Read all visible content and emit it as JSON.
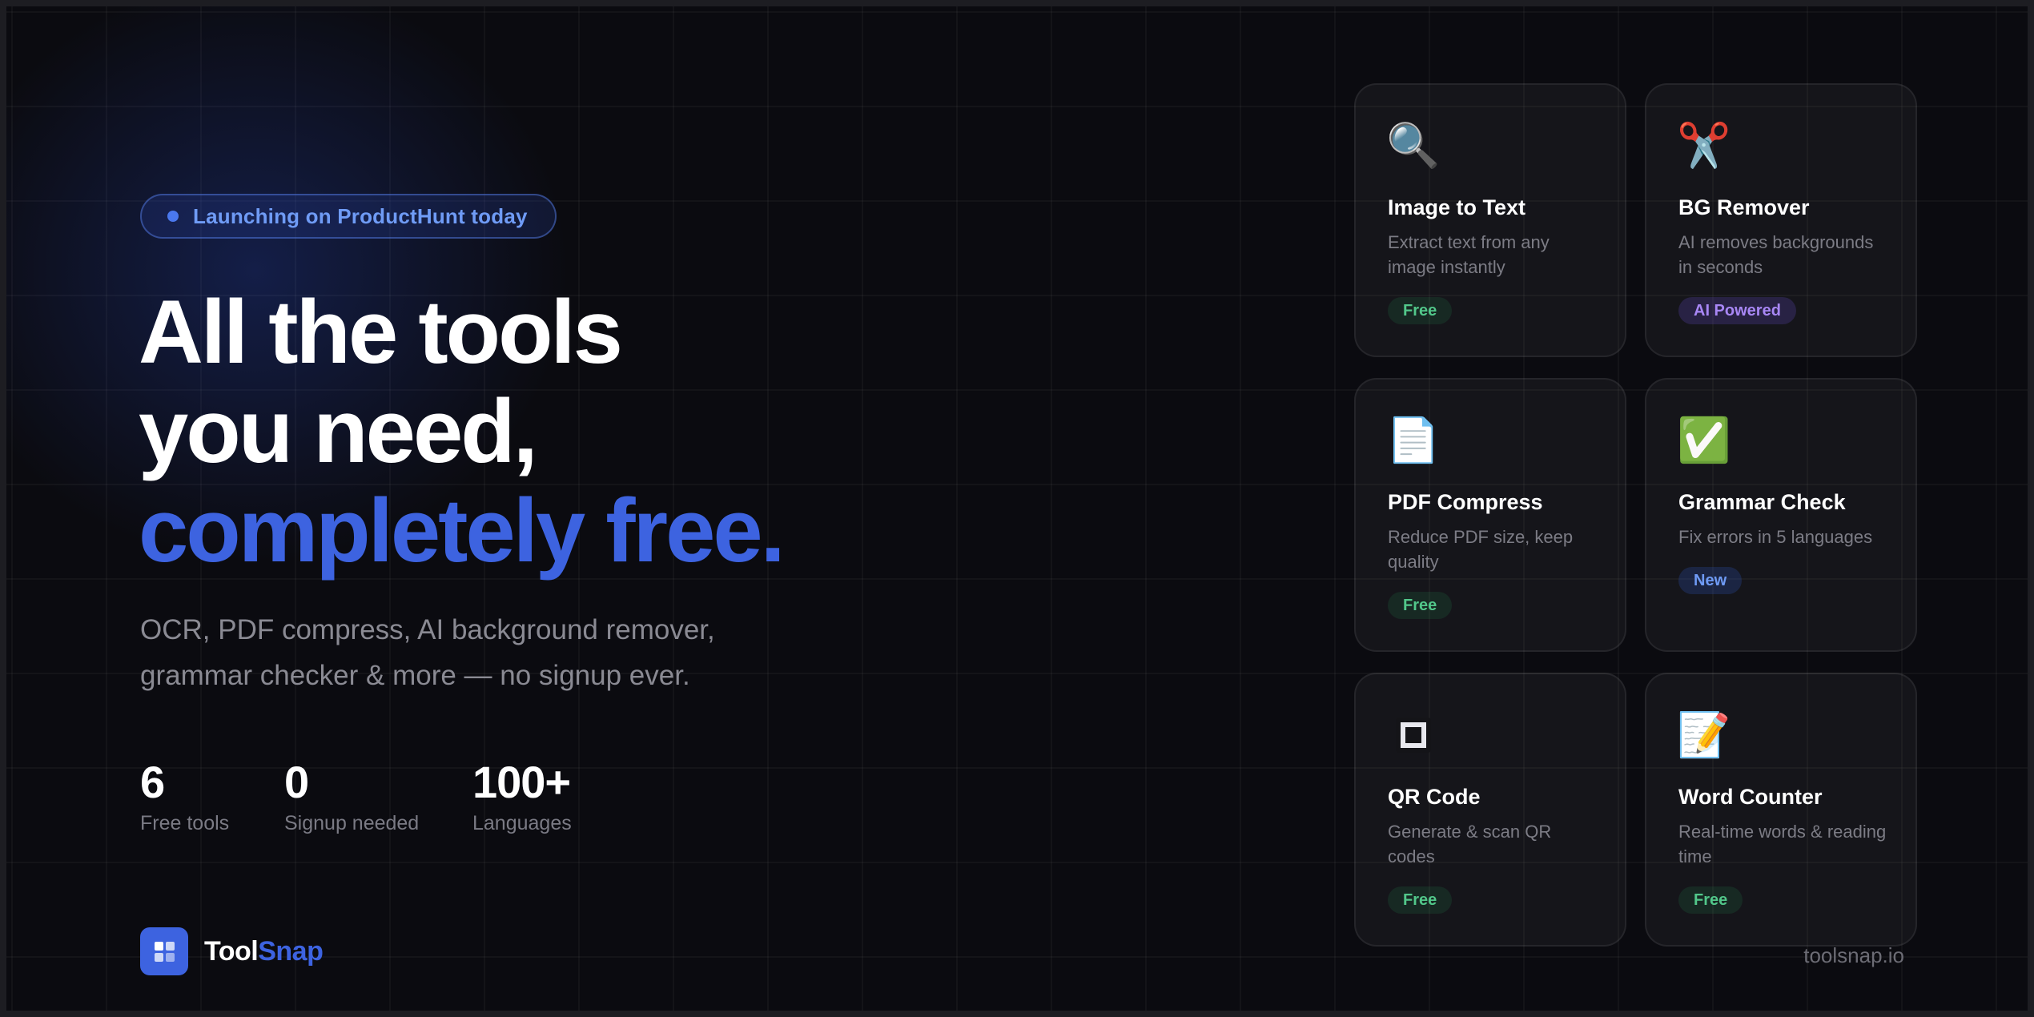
{
  "badge": {
    "text": "Launching on ProductHunt today"
  },
  "headline": {
    "line1": "All the tools",
    "line2": "you need,",
    "line3": "completely free."
  },
  "subtitle": {
    "line1": "OCR, PDF compress, AI background remover,",
    "line2": "grammar checker & more — no signup ever."
  },
  "stats": [
    {
      "value": "6",
      "label": "Free tools"
    },
    {
      "value": "0",
      "label": "Signup needed"
    },
    {
      "value": "100+",
      "label": "Languages"
    }
  ],
  "brand": {
    "part1": "Tool",
    "part2": "Snap"
  },
  "site": "toolsnap.io",
  "colors": {
    "accent": "#3d63e0",
    "tag_free": "#52c78a",
    "tag_ai": "#a887f5",
    "tag_new": "#6f9bf5"
  },
  "cards": [
    {
      "icon": "magnifier-icon",
      "glyph": "🔍",
      "title": "Image to Text",
      "desc": "Extract text from any image instantly",
      "tag": "Free"
    },
    {
      "icon": "scissors-icon",
      "glyph": "✂️",
      "title": "BG Remover",
      "desc": "AI removes backgrounds in seconds",
      "tag": "AI Powered"
    },
    {
      "icon": "document-icon",
      "glyph": "📄",
      "title": "PDF Compress",
      "desc": "Reduce PDF size, keep quality",
      "tag": "Free"
    },
    {
      "icon": "checkmark-icon",
      "glyph": "✅",
      "title": "Grammar Check",
      "desc": "Fix errors in 5 languages",
      "tag": "New"
    },
    {
      "icon": "qr-code-icon",
      "glyph": "",
      "title": "QR Code",
      "desc": "Generate & scan QR codes",
      "tag": "Free"
    },
    {
      "icon": "memo-icon",
      "glyph": "📝",
      "title": "Word Counter",
      "desc": "Real-time words & reading time",
      "tag": "Free"
    }
  ]
}
